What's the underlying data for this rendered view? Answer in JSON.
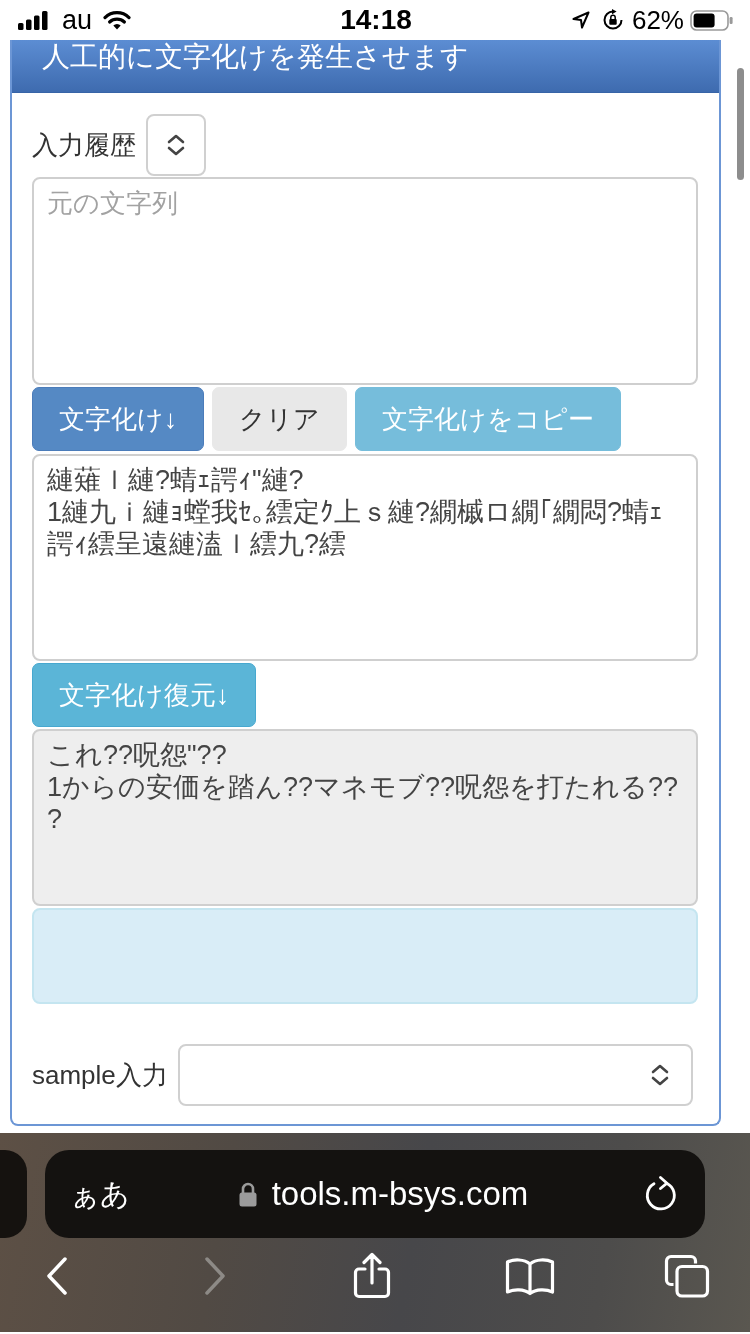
{
  "status_bar": {
    "carrier": "au",
    "time": "14:18",
    "battery": "62%"
  },
  "panel": {
    "title": "人工的に文字化けを発生させます"
  },
  "history": {
    "label": "入力履歴"
  },
  "source": {
    "placeholder": "元の文字列"
  },
  "actions": [
    {
      "label": "文字化け↓",
      "kind": "primary"
    },
    {
      "label": "クリア",
      "kind": "default"
    },
    {
      "label": "文字化けをコピー",
      "kind": "info"
    }
  ],
  "garbled": {
    "value": "縺薙ｌ縺?蜻ｪ諤ｨ\"縺?\n1縺九ｉ縺ｮ螳我ｾ｡繧定ｸ上ｓ縺?繝槭ロ繝｢繝悶?蜻ｪ諤ｨ繧呈遠縺溘ｌ繧九?繧"
  },
  "restore_button": {
    "label": "文字化け復元↓",
    "kind": "accent"
  },
  "restored": {
    "value": "これ??呪怨\"??\n1からの安価を踏ん??マネモブ??呪怨を打たれる???",
    "readonly": true
  },
  "sample": {
    "label": "sample入力"
  },
  "browser": {
    "text_size": "ぁあ",
    "url": "tools.m-bsys.com",
    "toolbar": [
      {
        "kind": "back",
        "disabled": false
      },
      {
        "kind": "forward",
        "disabled": true
      },
      {
        "kind": "share",
        "disabled": false
      },
      {
        "kind": "bookmarks",
        "disabled": false
      },
      {
        "kind": "tabs",
        "disabled": false
      }
    ]
  }
}
